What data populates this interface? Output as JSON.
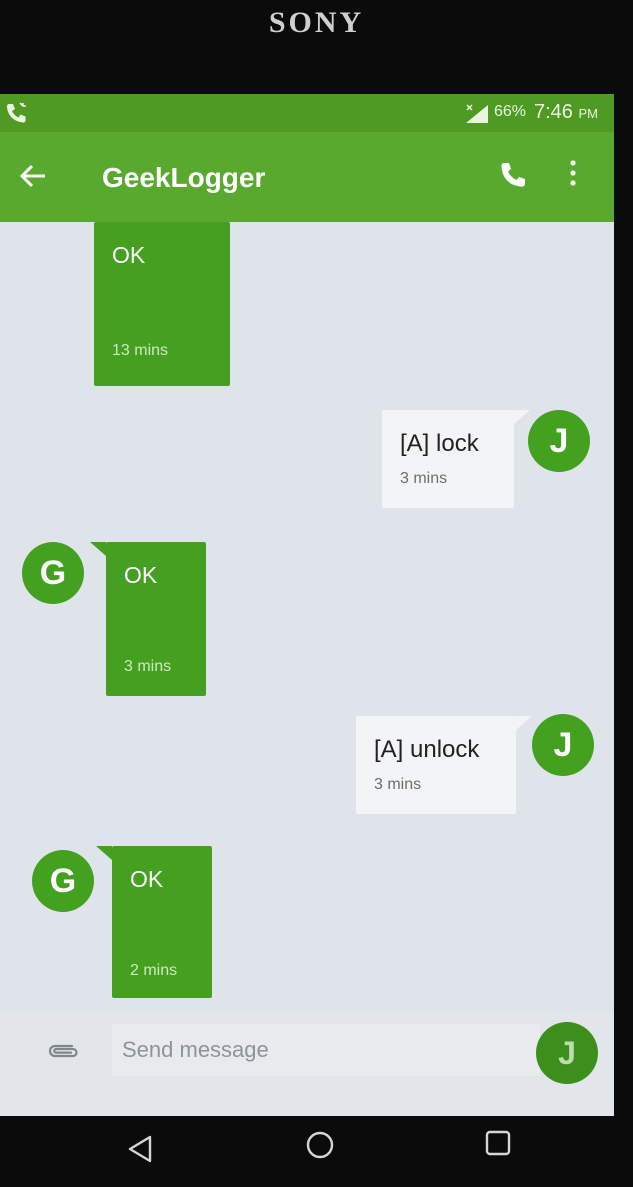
{
  "device": {
    "brand": "SONY"
  },
  "status_bar": {
    "battery": "66%",
    "time": "7:46",
    "ampm": "PM"
  },
  "app_bar": {
    "title": "GeekLogger"
  },
  "messages": [
    {
      "text": "OK",
      "time": "13 mins"
    },
    {
      "text": "[A] lock",
      "time": "3 mins",
      "avatar": "J"
    },
    {
      "text": "OK",
      "time": "3 mins",
      "avatar": "G"
    },
    {
      "text": "[A] unlock",
      "time": "3 mins",
      "avatar": "J"
    },
    {
      "text": "OK",
      "time": "2 mins",
      "avatar": "G"
    }
  ],
  "composer": {
    "placeholder": "Send message",
    "avatar": "J"
  },
  "colors": {
    "appbar": "#5aa92f",
    "statusbar": "#4e9a22",
    "bubble_in": "#45a021",
    "bubble_out": "#f3f4f5"
  },
  "icons": [
    "phone-call-icon",
    "signal-icon",
    "back-arrow-icon",
    "phone-icon",
    "more-vert-icon",
    "paperclip-icon",
    "nav-back-icon",
    "nav-home-icon",
    "nav-recents-icon"
  ]
}
